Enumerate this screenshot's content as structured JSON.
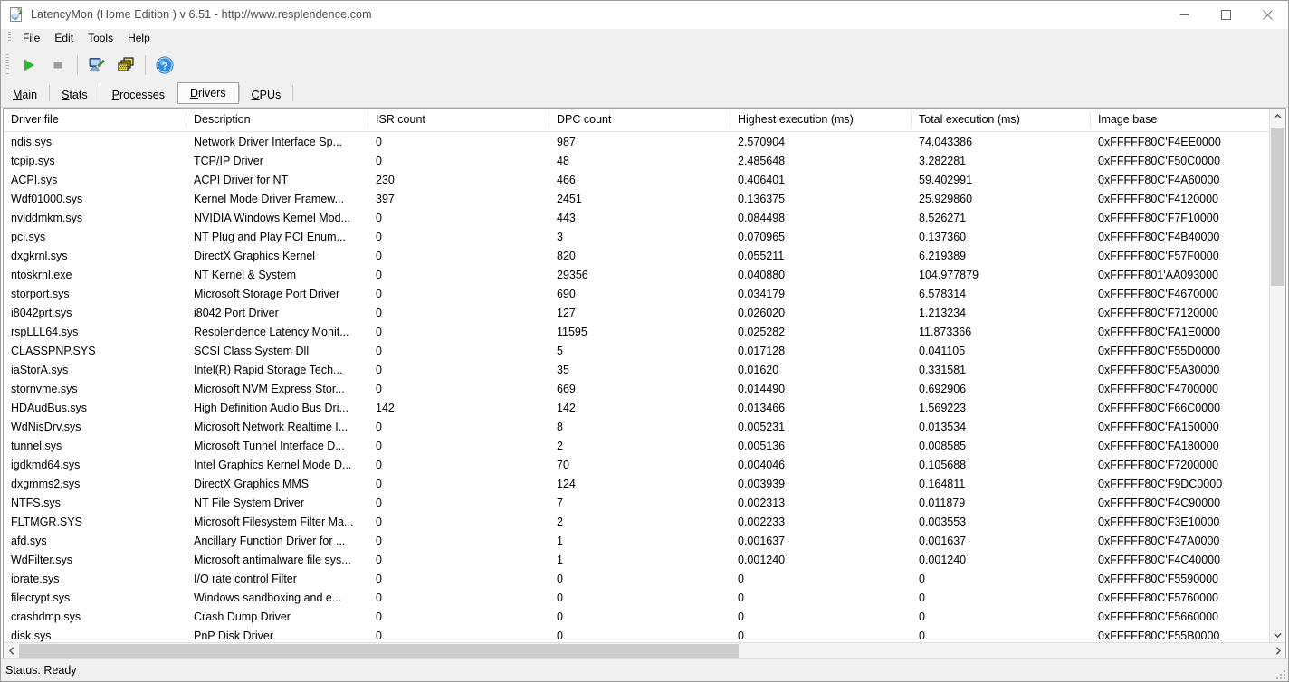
{
  "window": {
    "title": "LatencyMon  (Home Edition )  v 6.51 - http://www.resplendence.com",
    "icon": "latencymon-app-icon",
    "controls": {
      "minimize": "minimize-icon",
      "maximize": "maximize-icon",
      "close": "close-icon"
    }
  },
  "menubar": {
    "items": [
      {
        "label": "File",
        "mnemonic": "F"
      },
      {
        "label": "Edit",
        "mnemonic": "E"
      },
      {
        "label": "Tools",
        "mnemonic": "T"
      },
      {
        "label": "Help",
        "mnemonic": "H"
      }
    ]
  },
  "toolbar": {
    "buttons": [
      {
        "name": "start-monitoring-button",
        "icon": "green-play-triangle-icon",
        "enabled": true
      },
      {
        "name": "stop-monitoring-button",
        "icon": "gray-stop-square-icon",
        "enabled": false
      },
      {
        "name": "system-info-button",
        "icon": "computer-with-pen-icon",
        "enabled": true
      },
      {
        "name": "copy-report-button",
        "icon": "stacked-windows-icon",
        "enabled": true
      },
      {
        "name": "help-button",
        "icon": "blue-question-mark-icon",
        "enabled": true
      }
    ]
  },
  "tabs": {
    "selected": "Drivers",
    "items": [
      {
        "label": "Main",
        "mnemonic": "M"
      },
      {
        "label": "Stats",
        "mnemonic": "S"
      },
      {
        "label": "Processes",
        "mnemonic": "P"
      },
      {
        "label": "Drivers",
        "mnemonic": "D"
      },
      {
        "label": "CPUs",
        "mnemonic": "C"
      }
    ]
  },
  "table": {
    "columns": [
      "Driver file",
      "Description",
      "ISR count",
      "DPC count",
      "Highest execution (ms)",
      "Total execution (ms)",
      "Image base"
    ],
    "rows": [
      [
        "ndis.sys",
        "Network Driver Interface Sp...",
        "0",
        "987",
        "2.570904",
        "74.043386",
        "0xFFFFF80C'F4EE0000"
      ],
      [
        "tcpip.sys",
        "TCP/IP Driver",
        "0",
        "48",
        "2.485648",
        "3.282281",
        "0xFFFFF80C'F50C0000"
      ],
      [
        "ACPI.sys",
        "ACPI Driver for NT",
        "230",
        "466",
        "0.406401",
        "59.402991",
        "0xFFFFF80C'F4A60000"
      ],
      [
        "Wdf01000.sys",
        "Kernel Mode Driver Framew...",
        "397",
        "2451",
        "0.136375",
        "25.929860",
        "0xFFFFF80C'F4120000"
      ],
      [
        "nvlddmkm.sys",
        "NVIDIA Windows Kernel Mod...",
        "0",
        "443",
        "0.084498",
        "8.526271",
        "0xFFFFF80C'F7F10000"
      ],
      [
        "pci.sys",
        "NT Plug and Play PCI Enum...",
        "0",
        "3",
        "0.070965",
        "0.137360",
        "0xFFFFF80C'F4B40000"
      ],
      [
        "dxgkrnl.sys",
        "DirectX Graphics Kernel",
        "0",
        "820",
        "0.055211",
        "6.219389",
        "0xFFFFF80C'F57F0000"
      ],
      [
        "ntoskrnl.exe",
        "NT Kernel & System",
        "0",
        "29356",
        "0.040880",
        "104.977879",
        "0xFFFFF801'AA093000"
      ],
      [
        "storport.sys",
        "Microsoft Storage Port Driver",
        "0",
        "690",
        "0.034179",
        "6.578314",
        "0xFFFFF80C'F4670000"
      ],
      [
        "i8042prt.sys",
        "i8042 Port Driver",
        "0",
        "127",
        "0.026020",
        "1.213234",
        "0xFFFFF80C'F7120000"
      ],
      [
        "rspLLL64.sys",
        "Resplendence Latency Monit...",
        "0",
        "11595",
        "0.025282",
        "11.873366",
        "0xFFFFF80C'FA1E0000"
      ],
      [
        "CLASSPNP.SYS",
        "SCSI Class System Dll",
        "0",
        "5",
        "0.017128",
        "0.041105",
        "0xFFFFF80C'F55D0000"
      ],
      [
        "iaStorA.sys",
        "Intel(R) Rapid Storage Tech...",
        "0",
        "35",
        "0.01620",
        "0.331581",
        "0xFFFFF80C'F5A30000"
      ],
      [
        "stornvme.sys",
        "Microsoft NVM Express Stor...",
        "0",
        "669",
        "0.014490",
        "0.692906",
        "0xFFFFF80C'F4700000"
      ],
      [
        "HDAudBus.sys",
        "High Definition Audio Bus Dri...",
        "142",
        "142",
        "0.013466",
        "1.569223",
        "0xFFFFF80C'F66C0000"
      ],
      [
        "WdNisDrv.sys",
        "Microsoft Network Realtime I...",
        "0",
        "8",
        "0.005231",
        "0.013534",
        "0xFFFFF80C'FA150000"
      ],
      [
        "tunnel.sys",
        "Microsoft Tunnel Interface D...",
        "0",
        "2",
        "0.005136",
        "0.008585",
        "0xFFFFF80C'FA180000"
      ],
      [
        "igdkmd64.sys",
        "Intel Graphics Kernel Mode D...",
        "0",
        "70",
        "0.004046",
        "0.105688",
        "0xFFFFF80C'F7200000"
      ],
      [
        "dxgmms2.sys",
        "DirectX Graphics MMS",
        "0",
        "124",
        "0.003939",
        "0.164811",
        "0xFFFFF80C'F9DC0000"
      ],
      [
        "NTFS.sys",
        "NT File System Driver",
        "0",
        "7",
        "0.002313",
        "0.011879",
        "0xFFFFF80C'F4C90000"
      ],
      [
        "FLTMGR.SYS",
        "Microsoft Filesystem Filter Ma...",
        "0",
        "2",
        "0.002233",
        "0.003553",
        "0xFFFFF80C'F3E10000"
      ],
      [
        "afd.sys",
        "Ancillary Function Driver for ...",
        "0",
        "1",
        "0.001637",
        "0.001637",
        "0xFFFFF80C'F47A0000"
      ],
      [
        "WdFilter.sys",
        "Microsoft antimalware file sys...",
        "0",
        "1",
        "0.001240",
        "0.001240",
        "0xFFFFF80C'F4C40000"
      ],
      [
        "iorate.sys",
        "I/O rate control Filter",
        "0",
        "0",
        "0",
        "0",
        "0xFFFFF80C'F5590000"
      ],
      [
        "filecrypt.sys",
        "Windows sandboxing and e...",
        "0",
        "0",
        "0",
        "0",
        "0xFFFFF80C'F5760000"
      ],
      [
        "crashdmp.sys",
        "Crash Dump Driver",
        "0",
        "0",
        "0",
        "0",
        "0xFFFFF80C'F5660000"
      ],
      [
        "disk.sys",
        "PnP Disk Driver",
        "0",
        "0",
        "0",
        "0",
        "0xFFFFF80C'F55B0000"
      ]
    ]
  },
  "scrollbars": {
    "vertical": {
      "up_icon": "chevron-up-icon",
      "down_icon": "chevron-down-icon"
    },
    "horizontal": {
      "left_icon": "chevron-left-icon",
      "right_icon": "chevron-right-icon"
    }
  },
  "statusbar": {
    "text": "Status: Ready"
  },
  "colors": {
    "chrome": "#f0f0f0",
    "list_bg": "#ffffff",
    "border": "#a7a7a7",
    "scroll_thumb": "#cdcdcd",
    "play_green": "#2eb82e",
    "help_blue": "#1d7fd4",
    "title_text": "#4a4a4a"
  }
}
